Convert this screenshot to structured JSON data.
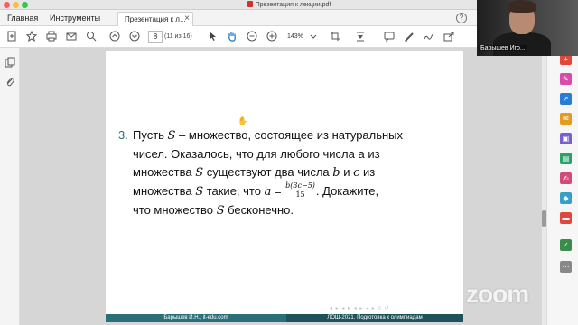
{
  "window": {
    "title": "Презентация к лекции.pdf"
  },
  "tabs": {
    "home": "Главная",
    "tools": "Инструменты",
    "document": "Презентация к л...",
    "close_glyph": "×",
    "help_glyph": "?"
  },
  "toolbar": {
    "page_input": "8",
    "page_count": "(11 из 16)",
    "zoom": "143%",
    "icons": [
      "add-file-icon",
      "bookmark-icon",
      "print-icon",
      "email-icon",
      "search-icon",
      "page-up-icon",
      "page-down-icon",
      "select-cursor-icon",
      "hand-icon",
      "zoom-out-icon",
      "zoom-in-icon",
      "zoom-dropdown-icon",
      "crop-icon",
      "scroll-mode-icon",
      "comment-icon",
      "highlight-icon",
      "sign-icon",
      "share-icon"
    ]
  },
  "problem": {
    "number": "3.",
    "line1_before": "Пусть ",
    "var_S": "S",
    "line1_after": " – множество, состоящее из натуральных",
    "line2": "чисел. Оказалось, что для любого числа a из",
    "line3_before": "множества ",
    "line3_mid": " существуют два числа ",
    "var_b": "b",
    "line3_and": " и ",
    "var_c": "c",
    "line3_after": " из",
    "line4_before": "множества ",
    "line4_mid": " такие, что ",
    "var_a": "a",
    "eq": " = ",
    "frac_num": "b(3c−5)",
    "frac_den": "15",
    "line4_after": ". Докажите,",
    "line5_before": "что множество ",
    "line5_after": " бесконечно."
  },
  "footer": {
    "left": "Барышев И.Н., it-edu.com",
    "right": "ЛОШ-2021. Подготовка к олимпиадам"
  },
  "video": {
    "participant_name": "Барышев Иго..."
  },
  "watermark": "zoom"
}
